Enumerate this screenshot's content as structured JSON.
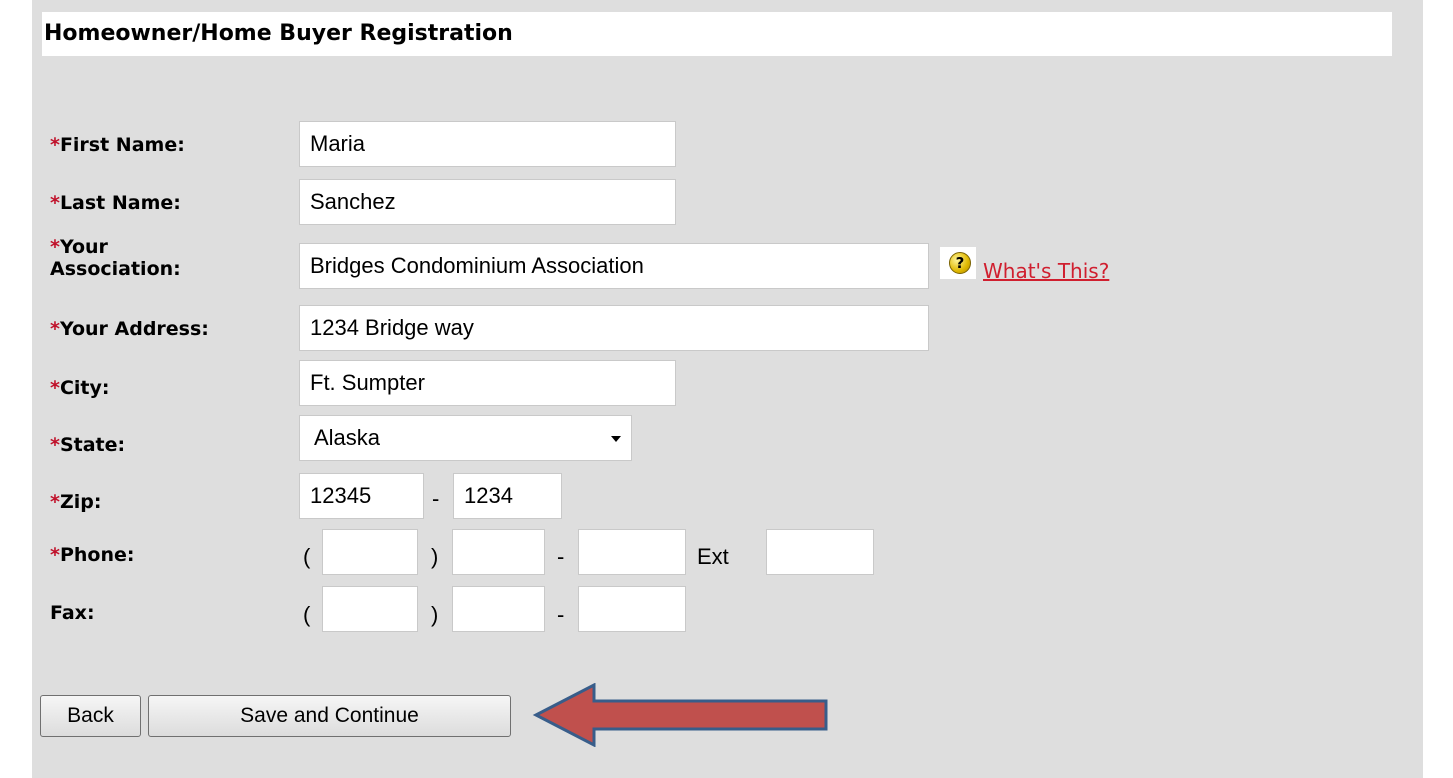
{
  "header": {
    "title": "Homeowner/Home Buyer Registration"
  },
  "form": {
    "required_mark": "*",
    "first_name": {
      "label": "First Name:",
      "value": "Maria"
    },
    "last_name": {
      "label": "Last Name:",
      "value": "Sanchez"
    },
    "association": {
      "label_line1": "Your",
      "label_line2": "Association:",
      "value": "Bridges Condominium Association",
      "help_link": "What's This?",
      "help_icon_glyph": "?"
    },
    "address": {
      "label": "Your Address:",
      "value": "1234 Bridge way"
    },
    "city": {
      "label": "City:",
      "value": "Ft. Sumpter"
    },
    "state": {
      "label": "State:",
      "value": "Alaska"
    },
    "zip": {
      "label": "Zip:",
      "value": "12345",
      "plus4": "1234",
      "separator": "-"
    },
    "phone": {
      "label": "Phone:",
      "open_paren": "(",
      "close_paren": ")",
      "dash": "-",
      "ext_label": "Ext",
      "area": "",
      "prefix": "",
      "line": "",
      "ext": ""
    },
    "fax": {
      "label": "Fax:",
      "open_paren": "(",
      "close_paren": ")",
      "dash": "-",
      "area": "",
      "prefix": "",
      "line": ""
    }
  },
  "buttons": {
    "back": "Back",
    "save_continue": "Save and Continue"
  },
  "annotation": {
    "arrow_fill": "#c0504d",
    "arrow_stroke": "#385d8a"
  }
}
